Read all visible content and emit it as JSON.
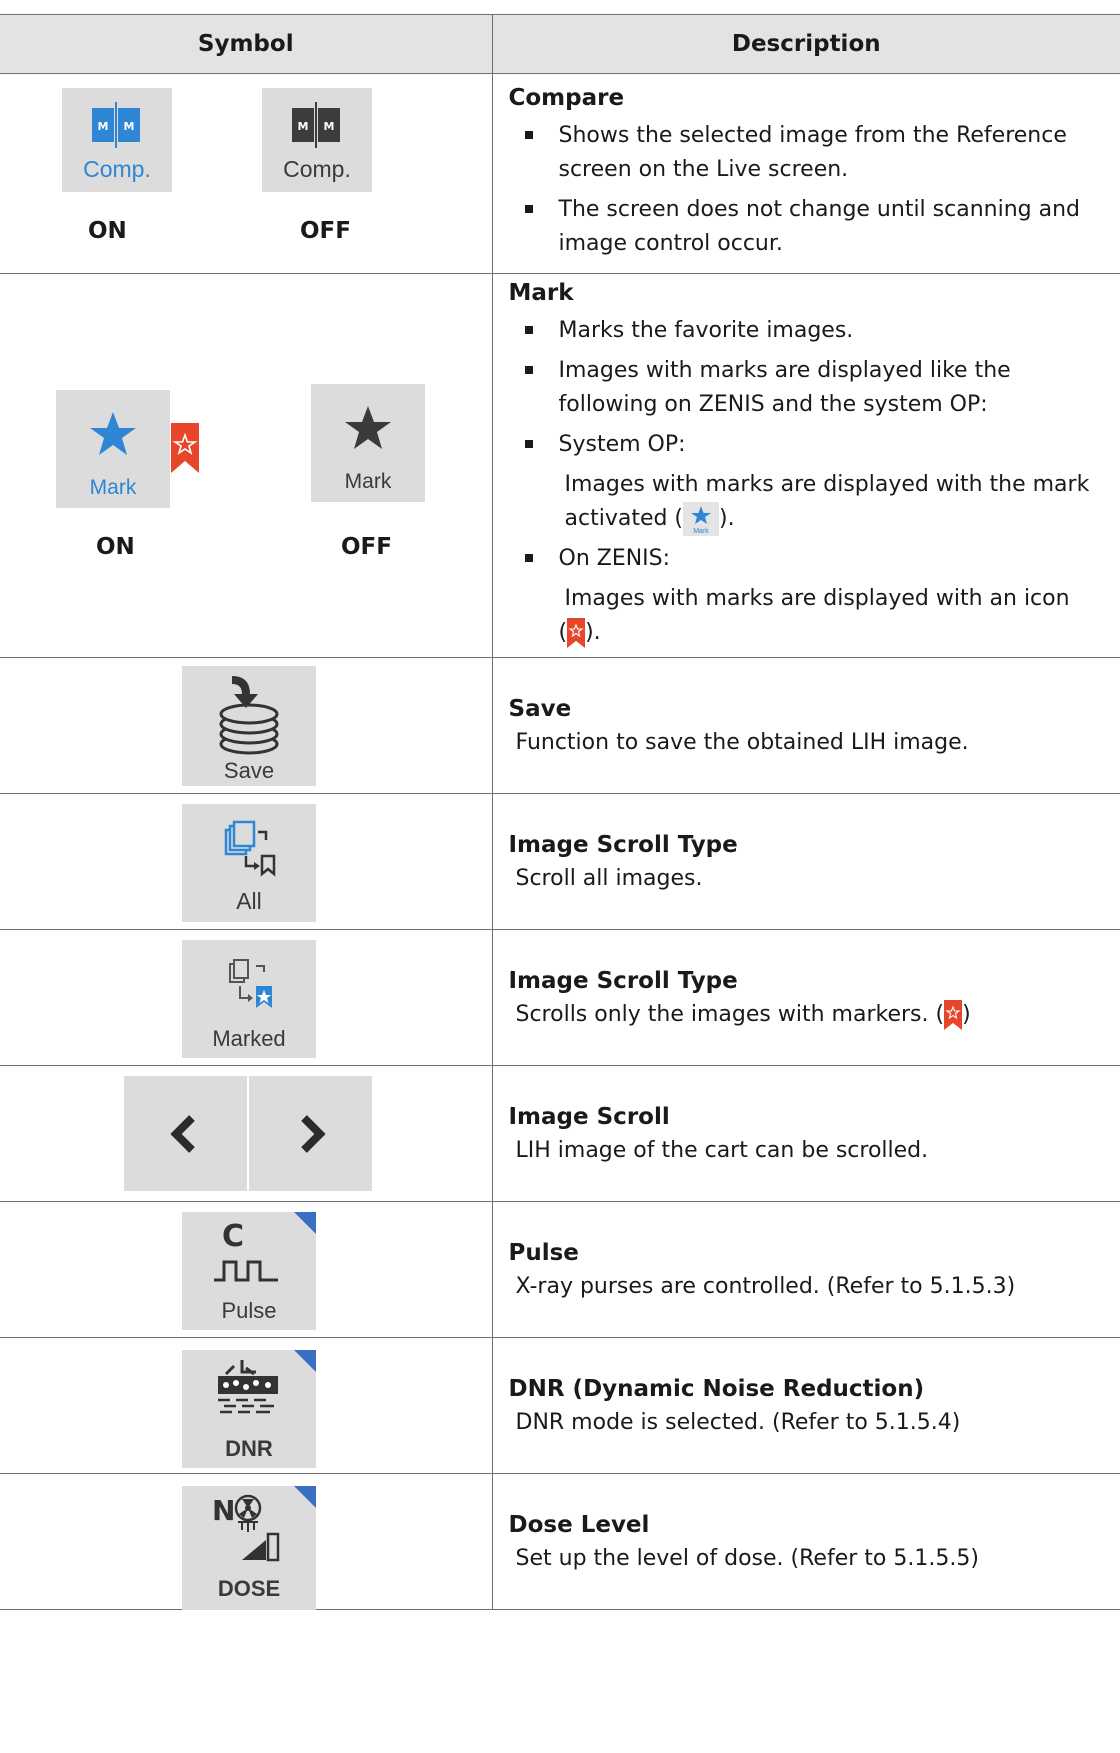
{
  "table": {
    "header_symbol": "Symbol",
    "header_description": "Description"
  },
  "colors": {
    "accent_blue": "#2e86d4",
    "bookmark_red": "#e8462a",
    "tile_gray": "#dcdcdc"
  },
  "rows": {
    "compare": {
      "title": "Compare",
      "bullets": [
        "Shows the selected image from the Reference screen on the Live screen.",
        "The screen does not change until scanning and image control occur."
      ],
      "icon_on_label": "Comp.",
      "icon_off_label": "Comp.",
      "icon_letter": "M",
      "state_on": "ON",
      "state_off": "OFF"
    },
    "mark": {
      "title": "Mark",
      "bullet1": "Marks the favorite images.",
      "bullet2": "Images with marks are displayed like the following on ZENIS and the system OP:",
      "bullet3": "System OP:",
      "sub3a": "Images with marks are displayed with the mark",
      "sub3b_pre": "activated (",
      "sub3b_post": ").",
      "bullet4": "On ZENIS:",
      "sub4a": "Images with marks are displayed with an icon",
      "sub4b_pre": "(",
      "sub4b_post": ").",
      "icon_on_label": "Mark",
      "icon_off_label": "Mark",
      "state_on": "ON",
      "state_off": "OFF"
    },
    "save": {
      "title": "Save",
      "text": "Function to save the obtained LIH image.",
      "icon_label": "Save"
    },
    "scroll_all": {
      "title": "Image Scroll Type",
      "text": "Scroll all images.",
      "icon_label": "All"
    },
    "scroll_marked": {
      "title": "Image Scroll Type",
      "text_pre": "Scrolls only the images with markers. (",
      "text_post": ")",
      "icon_label": "Marked"
    },
    "image_scroll": {
      "title": "Image Scroll",
      "text": "LIH image of the cart can be scrolled."
    },
    "pulse": {
      "title": "Pulse",
      "text": "X-ray purses are controlled. (Refer to 5.1.5.3)",
      "icon_label": "Pulse",
      "icon_letter": "C"
    },
    "dnr": {
      "title": "DNR (Dynamic Noise Reduction)",
      "text": "DNR mode is selected. (Refer to 5.1.5.4)",
      "icon_label": "DNR"
    },
    "dose": {
      "title": "Dose Level",
      "text": "Set up the level of dose. (Refer to 5.1.5.5)",
      "icon_label": "DOSE",
      "icon_letter": "N"
    }
  }
}
